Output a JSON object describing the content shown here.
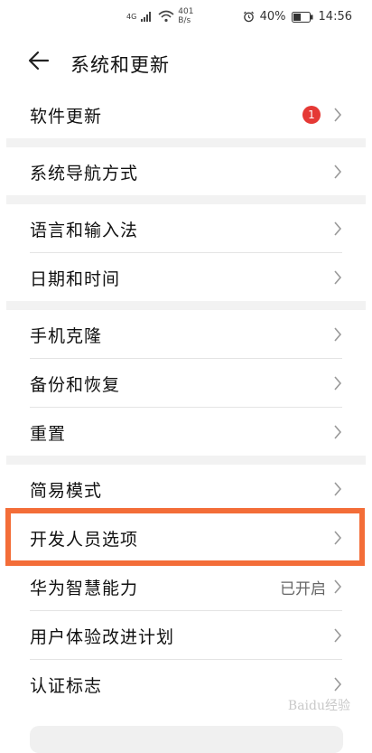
{
  "status_bar": {
    "signal": "4G",
    "net_speed_value": "401",
    "net_speed_unit": "B/s",
    "alarm_icon": "alarm-clock-icon",
    "battery_percent": "40%",
    "time": "14:56"
  },
  "header": {
    "back_icon": "arrow-left-icon",
    "title": "系统和更新"
  },
  "groups": [
    {
      "items": [
        {
          "label": "软件更新",
          "badge": "1"
        }
      ]
    },
    {
      "items": [
        {
          "label": "系统导航方式"
        }
      ]
    },
    {
      "items": [
        {
          "label": "语言和输入法"
        },
        {
          "label": "日期和时间"
        }
      ]
    },
    {
      "items": [
        {
          "label": "手机克隆"
        },
        {
          "label": "备份和恢复"
        },
        {
          "label": "重置"
        }
      ]
    },
    {
      "items": [
        {
          "label": "简易模式"
        },
        {
          "label": "开发人员选项",
          "highlighted": true
        },
        {
          "label": "华为智慧能力",
          "value": "已开启"
        },
        {
          "label": "用户体验改进计划"
        },
        {
          "label": "认证标志"
        }
      ]
    }
  ],
  "colors": {
    "highlight_border": "#f36d38",
    "badge": "#e53935",
    "separator": "#f2f2f2"
  },
  "watermark": "Baidu经验"
}
